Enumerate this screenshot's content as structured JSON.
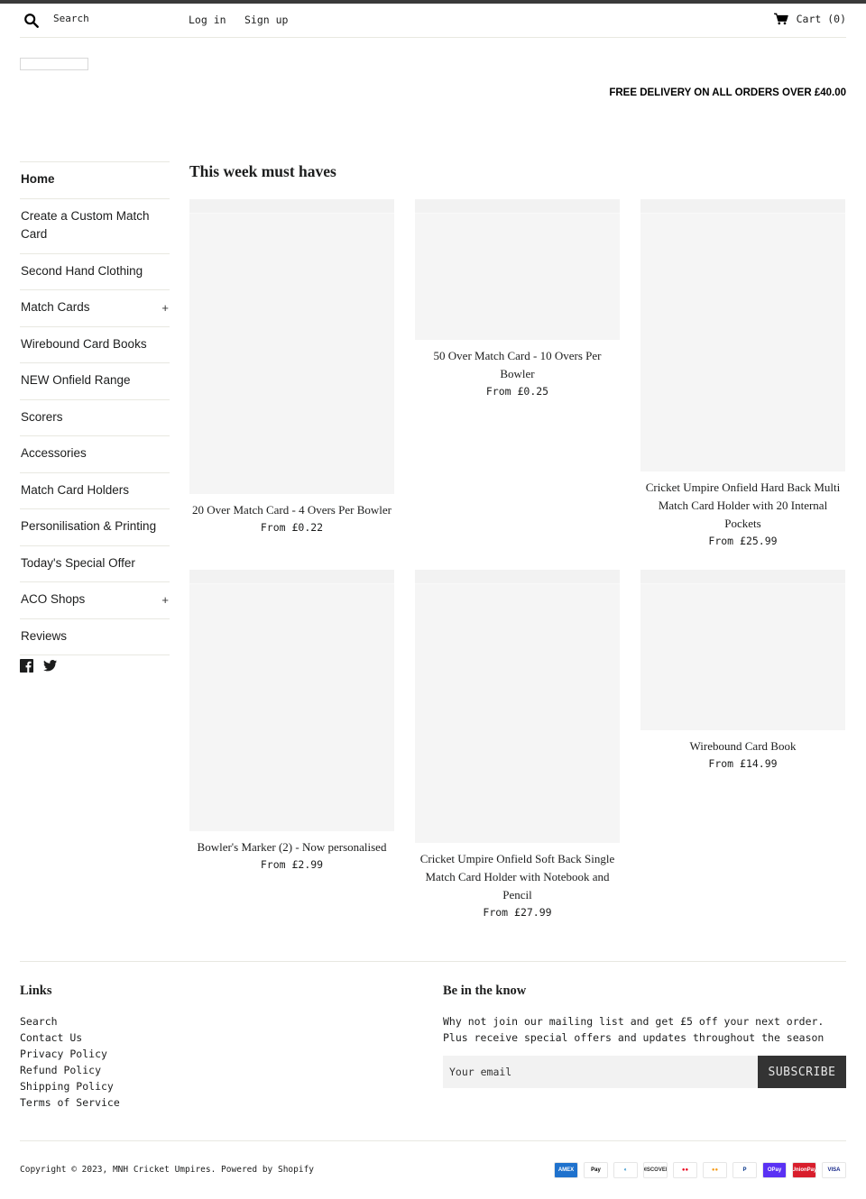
{
  "header": {
    "search_label": "Search",
    "login": "Log in",
    "signup": "Sign up",
    "cart_label": "Cart (0)"
  },
  "promo": "FREE DELIVERY ON ALL ORDERS OVER £40.00",
  "sidebar": {
    "items": [
      {
        "label": "Home",
        "active": true,
        "expandable": false
      },
      {
        "label": "Create a Custom Match Card",
        "expandable": false
      },
      {
        "label": "Second Hand Clothing",
        "expandable": false
      },
      {
        "label": "Match Cards",
        "expandable": true
      },
      {
        "label": "Wirebound Card Books",
        "expandable": false
      },
      {
        "label": "NEW Onfield Range",
        "expandable": false
      },
      {
        "label": "Scorers",
        "expandable": false
      },
      {
        "label": "Accessories",
        "expandable": false
      },
      {
        "label": "Match Card Holders",
        "expandable": false
      },
      {
        "label": "Personilisation & Printing",
        "expandable": false
      },
      {
        "label": "Today's Special Offer",
        "expandable": false
      },
      {
        "label": "ACO Shops",
        "expandable": true
      },
      {
        "label": "Reviews",
        "expandable": false
      }
    ],
    "plus_symbol": "+",
    "social": [
      "facebook",
      "twitter"
    ]
  },
  "main": {
    "section_title": "This week must haves",
    "products": [
      {
        "title": "20 Over Match Card - 4 Overs Per Bowler",
        "price": "From £0.22"
      },
      {
        "title": "50 Over Match Card - 10 Overs Per Bowler",
        "price": "From £0.25"
      },
      {
        "title": "Cricket Umpire Onfield Hard Back Multi Match Card Holder with 20 Internal Pockets",
        "price": "From £25.99"
      },
      {
        "title": "Bowler's Marker (2) - Now personalised",
        "price": "From £2.99"
      },
      {
        "title": "Cricket Umpire Onfield Soft Back Single Match Card Holder with Notebook and Pencil",
        "price": "From £27.99"
      },
      {
        "title": "Wirebound Card Book",
        "price": "From £14.99"
      }
    ]
  },
  "footer": {
    "links_heading": "Links",
    "links": [
      "Search",
      "Contact Us",
      "Privacy Policy",
      "Refund Policy",
      "Shipping Policy",
      "Terms of Service"
    ],
    "newsletter_heading": "Be in the know",
    "newsletter_text": "Why not join our mailing list and get £5 off your next order. Plus receive special offers and updates throughout the season",
    "email_placeholder": "Your email",
    "subscribe_label": "SUBSCRIBE",
    "copyright": "Copyright © 2023, MNH Cricket Umpires. Powered by Shopify",
    "payment_methods": [
      {
        "name": "amex",
        "label": "AMEX",
        "bg": "#1f72cd",
        "fg": "#ffffff"
      },
      {
        "name": "apple-pay",
        "label": " Pay",
        "bg": "#ffffff",
        "fg": "#000000"
      },
      {
        "name": "diners-club",
        "label": "◐",
        "bg": "#ffffff",
        "fg": "#0079be"
      },
      {
        "name": "discover",
        "label": "DISCOVER",
        "bg": "#ffffff",
        "fg": "#333333"
      },
      {
        "name": "maestro",
        "label": "●●",
        "bg": "#ffffff",
        "fg": "#eb001b"
      },
      {
        "name": "mastercard",
        "label": "●●",
        "bg": "#ffffff",
        "fg": "#f79e1b"
      },
      {
        "name": "paypal",
        "label": "P",
        "bg": "#ffffff",
        "fg": "#003087"
      },
      {
        "name": "shop-pay",
        "label": "OPay",
        "bg": "#5a31f4",
        "fg": "#ffffff"
      },
      {
        "name": "union-pay",
        "label": "UnionPay",
        "bg": "#d81e2c",
        "fg": "#ffffff"
      },
      {
        "name": "visa",
        "label": "VISA",
        "bg": "#ffffff",
        "fg": "#142688"
      }
    ]
  }
}
